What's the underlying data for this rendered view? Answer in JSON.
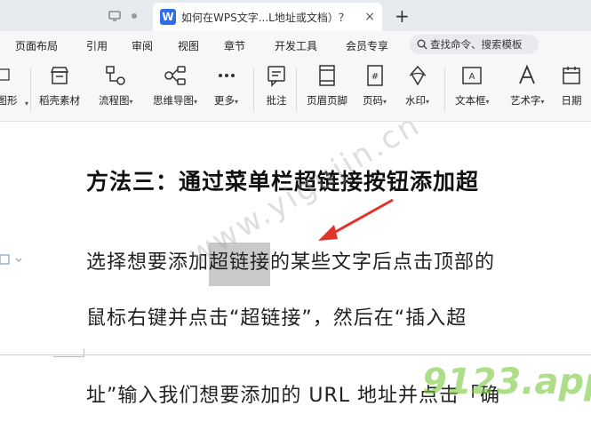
{
  "window": {
    "tab_title": "如何在WPS文字...L地址或文档）？",
    "tab_logo": "W",
    "close_glyph": "×",
    "new_tab_glyph": "+"
  },
  "menu": {
    "items": [
      "页面布局",
      "引用",
      "审阅",
      "视图",
      "章节",
      "开发工具",
      "会员专享"
    ],
    "search_label": "查找命令、搜索模板"
  },
  "ribbon": {
    "left_cut_label": "图形",
    "tools": [
      {
        "id": "daoke",
        "label": "稻壳素材",
        "icon": "store-icon",
        "dropdown": false
      },
      {
        "id": "flow",
        "label": "流程图",
        "icon": "flowchart-icon",
        "dropdown": true
      },
      {
        "id": "mind",
        "label": "思维导图",
        "icon": "mindmap-icon",
        "dropdown": true
      },
      {
        "id": "more",
        "label": "更多",
        "icon": "more-icon",
        "dropdown": true
      },
      {
        "id": "comment",
        "label": "批注",
        "icon": "comment-icon",
        "dropdown": false
      },
      {
        "id": "header",
        "label": "页眉页脚",
        "icon": "header-footer-icon",
        "dropdown": false
      },
      {
        "id": "pagenum",
        "label": "页码",
        "icon": "page-number-icon",
        "dropdown": true
      },
      {
        "id": "watermark",
        "label": "水印",
        "icon": "watermark-icon",
        "dropdown": true
      },
      {
        "id": "textbox",
        "label": "文本框",
        "icon": "textbox-icon",
        "dropdown": true
      },
      {
        "id": "wordart",
        "label": "艺术字",
        "icon": "wordart-icon",
        "dropdown": true
      },
      {
        "id": "date",
        "label": "日期",
        "icon": "calendar-icon",
        "dropdown": false
      }
    ]
  },
  "document": {
    "heading": "方法三：通过菜单栏超链接按钮添加超",
    "line1_before": "选择想要添加",
    "line1_selected": "超链接",
    "line1_after": "的某些文字后点击顶部的",
    "line2": "鼠标右键并点击“超链接”，然后在“插入超",
    "line3": "址”输入我们想要添加的 URL 地址并点击「确"
  },
  "watermarks": {
    "site": "www.yigujin.cn",
    "brand": "9123.app"
  },
  "colors": {
    "accent": "#2c6fe8",
    "arrow": "#e0332b",
    "selection": "#c9c9c9"
  }
}
